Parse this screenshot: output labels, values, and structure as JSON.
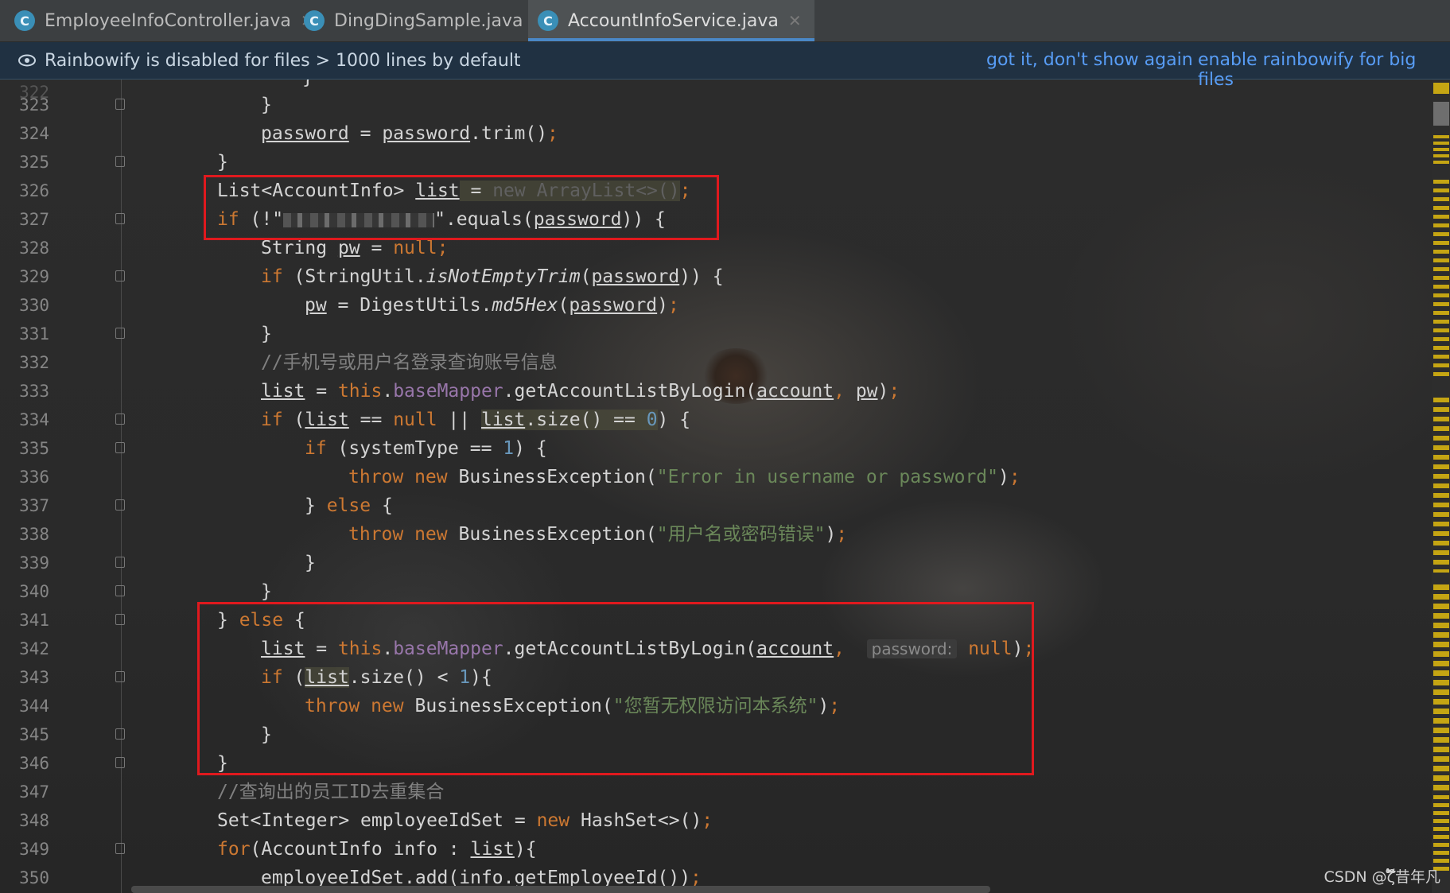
{
  "tabs": [
    {
      "label": "EmployeeInfoController.java",
      "icon": "class-icon",
      "icon_letter": "C"
    },
    {
      "label": "DingDingSample.java",
      "icon": "class-icon",
      "icon_letter": "C"
    },
    {
      "label": "AccountInfoService.java",
      "icon": "class-icon",
      "icon_letter": "C",
      "active": true
    }
  ],
  "banner": {
    "message": "Rainbowify is disabled for files > 1000 lines by default",
    "link_dismiss": "got it, don't show again",
    "link_enable": "enable rainbowify for big files"
  },
  "line_numbers": [
    "323",
    "324",
    "325",
    "326",
    "327",
    "328",
    "329",
    "330",
    "331",
    "332",
    "333",
    "334",
    "335",
    "336",
    "337",
    "338",
    "339",
    "340",
    "341",
    "342",
    "343",
    "344",
    "345",
    "346",
    "347",
    "348",
    "349",
    "350"
  ],
  "code": {
    "l323": "}",
    "l324_a": "password",
    "l324_b": " = ",
    "l324_c": "password",
    "l324_d": ".trim()",
    "l324_e": ";",
    "l325": "}",
    "l326_a": "List<AccountInfo> ",
    "l326_b": "list",
    "l326_c": " = ",
    "l326_d": "new ArrayList<>()",
    "l326_e": ";",
    "l327_a": "if",
    "l327_b": " (!\"",
    "l327_c": "\".equals(",
    "l327_d": "password",
    "l327_e": ")) {",
    "l328_a": "String ",
    "l328_b": "pw",
    "l328_c": " = ",
    "l328_d": "null",
    "l328_e": ";",
    "l329_a": "if",
    "l329_b": " (StringUtil.",
    "l329_c": "isNotEmptyTrim",
    "l329_d": "(",
    "l329_e": "password",
    "l329_f": ")) {",
    "l330_a": "pw",
    "l330_b": " = DigestUtils.",
    "l330_c": "md5Hex",
    "l330_d": "(",
    "l330_e": "password",
    "l330_f": ")",
    "l330_g": ";",
    "l331": "}",
    "l332": "//手机号或用户名登录查询账号信息",
    "l333_a": "list",
    "l333_b": " = ",
    "l333_c": "this",
    "l333_d": ".",
    "l333_e": "baseMapper",
    "l333_f": ".getAccountListByLogin(",
    "l333_g": "account",
    "l333_h": ", ",
    "l333_i": "pw",
    "l333_j": ")",
    "l333_k": ";",
    "l334_a": "if",
    "l334_b": " (",
    "l334_c": "list",
    "l334_d": " == ",
    "l334_e": "null",
    "l334_f": " || ",
    "l334_g": "list",
    "l334_h": ".size() == ",
    "l334_i": "0",
    "l334_j": ") {",
    "l335_a": "if",
    "l335_b": " (systemType == ",
    "l335_c": "1",
    "l335_d": ") {",
    "l336_a": "throw new",
    "l336_b": " BusinessException(",
    "l336_c": "\"Error in username or password\"",
    "l336_d": ")",
    "l336_e": ";",
    "l337_a": "} ",
    "l337_b": "else",
    "l337_c": " {",
    "l338_a": "throw new",
    "l338_b": " BusinessException(",
    "l338_c": "\"用户名或密码错误\"",
    "l338_d": ")",
    "l338_e": ";",
    "l339": "}",
    "l340": "}",
    "l341_a": "} ",
    "l341_b": "else",
    "l341_c": " {",
    "l342_a": "list",
    "l342_b": " = ",
    "l342_c": "this",
    "l342_d": ".",
    "l342_e": "baseMapper",
    "l342_f": ".getAccountListByLogin(",
    "l342_g": "account",
    "l342_h": ",  ",
    "l342_hint": "password:",
    "l342_i": " null",
    "l342_j": ")",
    "l342_k": ";",
    "l343_a": "if",
    "l343_b": " (",
    "l343_c": "list",
    "l343_d": ".size() < ",
    "l343_e": "1",
    "l343_f": "){",
    "l344_a": "throw new",
    "l344_b": " BusinessException(",
    "l344_c": "\"您暂无权限访问本系统\"",
    "l344_d": ")",
    "l344_e": ";",
    "l345": "}",
    "l346": "}",
    "l347": "//查询出的员工ID去重集合",
    "l348_a": "Set<Integer> employeeIdSet = ",
    "l348_b": "new",
    "l348_c": " HashSet<>()",
    "l348_d": ";",
    "l349_a": "for",
    "l349_b": "(AccountInfo info : ",
    "l349_c": "list",
    "l349_d": "){",
    "l350_a": "employeeIdSet.add(info.getEmployeeId())",
    "l350_b": ";"
  },
  "watermark": "CSDN @ζ໊້໊້໊້໊້໊້昔年凡",
  "colors": {
    "keyword": "#cc7832",
    "string": "#6a8759",
    "comment": "#808080",
    "number": "#6897bb",
    "field": "#9876aa",
    "highlight_box": "#e0191e",
    "link": "#589df6"
  }
}
